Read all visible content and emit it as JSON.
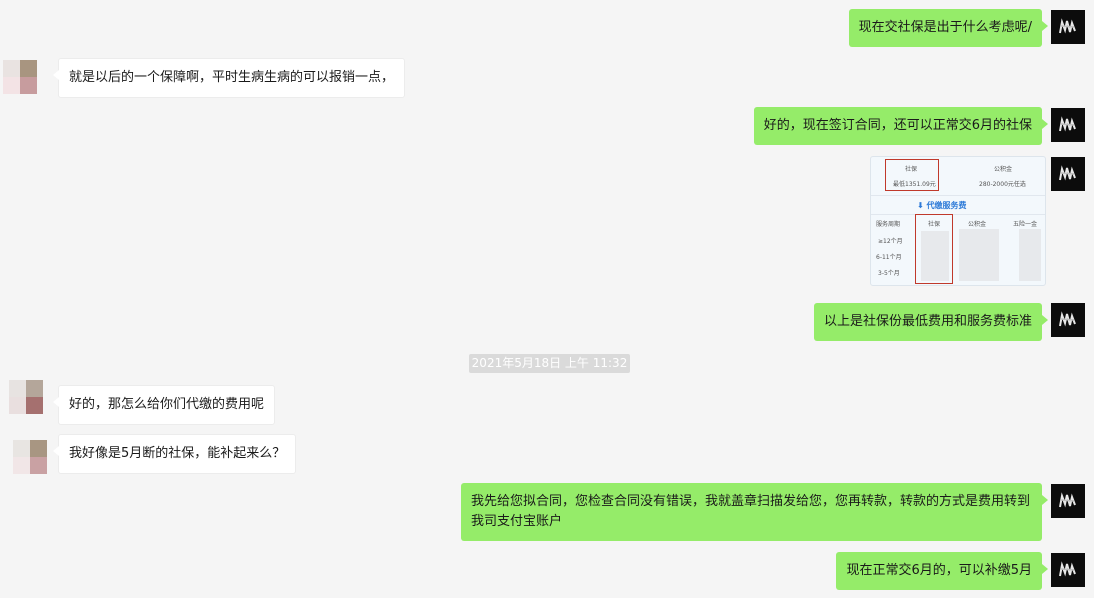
{
  "timestamp": "2021年5月18日 上午 11:32",
  "messages": [
    {
      "side": "right",
      "text": "现在交社保是出于什么考虑呢/"
    },
    {
      "side": "left",
      "text": "就是以后的一个保障啊，平时生病生病的可以报销一点，"
    },
    {
      "side": "right",
      "text": "好的，现在签订合同，还可以正常交6月的社保"
    },
    {
      "side": "right",
      "type": "image"
    },
    {
      "side": "right",
      "text": "以上是社保份最低费用和服务费标准"
    },
    {
      "side": "left",
      "text": "好的，那怎么给你们代缴的费用呢"
    },
    {
      "side": "left",
      "text": "我好像是5月断的社保，能补起来么？"
    },
    {
      "side": "right",
      "text": "我先给您拟合同，您检查合同没有错误，我就盖章扫描发给您，您再转款，转款的方式是费用转到我司支付宝账户"
    },
    {
      "side": "right",
      "text": "现在正常交6月的，可以补缴5月"
    }
  ],
  "image_content": {
    "col_shebao": "社保",
    "col_gongjijin": "公积金",
    "shebao_min": "最低1351.09元",
    "gongjijin_range": "280-2000元任选",
    "service_fee_title": "代缴服务费",
    "headers": [
      "服务周期",
      "社保",
      "公积金",
      "五险一金"
    ],
    "rows": [
      "≥12个月",
      "6-11个月",
      "3-5个月"
    ]
  },
  "colors": {
    "page_bg": "#f5f5f5",
    "bubble_right": "#95ec69",
    "bubble_left": "#ffffff",
    "timestamp_bg": "#dadada"
  }
}
